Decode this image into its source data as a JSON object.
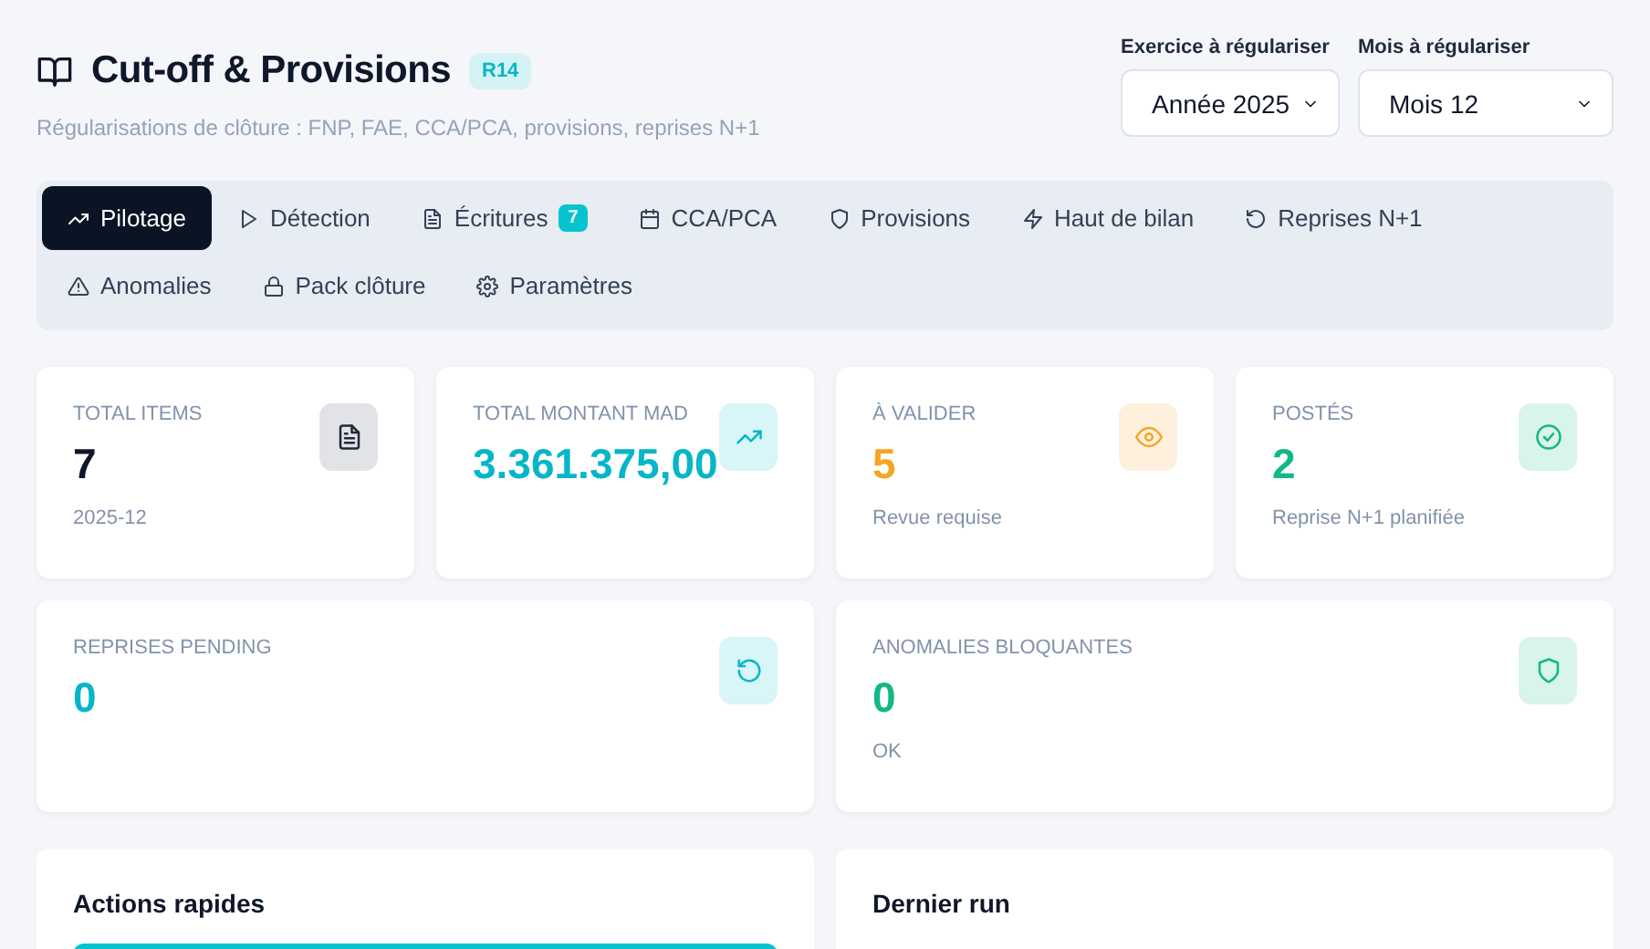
{
  "header": {
    "title": "Cut-off & Provisions",
    "badge": "R14",
    "subtitle": "Régularisations de clôture : FNP, FAE, CCA/PCA, provisions, reprises N+1"
  },
  "filters": [
    {
      "label": "Exercice à régulariser",
      "value": "Année 2025"
    },
    {
      "label": "Mois à régulariser",
      "value": "Mois 12"
    }
  ],
  "tabs": [
    {
      "label": "Pilotage",
      "selected": true
    },
    {
      "label": "Détection",
      "selected": false
    },
    {
      "label": "Écritures",
      "selected": false,
      "count": "7"
    },
    {
      "label": "CCA/PCA",
      "selected": false
    },
    {
      "label": "Provisions",
      "selected": false
    },
    {
      "label": "Haut de bilan",
      "selected": false
    },
    {
      "label": "Reprises N+1",
      "selected": false
    },
    {
      "label": "Anomalies",
      "selected": false
    },
    {
      "label": "Pack clôture",
      "selected": false
    },
    {
      "label": "Paramètres",
      "selected": false
    }
  ],
  "stats": [
    {
      "label": "TOTAL ITEMS",
      "value": "7",
      "note": "2025-12",
      "kind": "neutral"
    },
    {
      "label": "TOTAL MONTANT MAD",
      "value": "3.361.375,00",
      "kind": "info"
    },
    {
      "label": "À VALIDER",
      "value": "5",
      "note": "Revue requise",
      "kind": "warning"
    },
    {
      "label": "POSTÉS",
      "value": "2",
      "note": "Reprise N+1 planifiée",
      "kind": "success"
    },
    {
      "label": "REPRISES PENDING",
      "value": "0",
      "kind": "info"
    },
    {
      "label": "ANOMALIES BLOQUANTES",
      "value": "0",
      "note": "OK",
      "kind": "success"
    }
  ],
  "panels": [
    {
      "title": "Actions rapides"
    },
    {
      "title": "Dernier run"
    }
  ]
}
